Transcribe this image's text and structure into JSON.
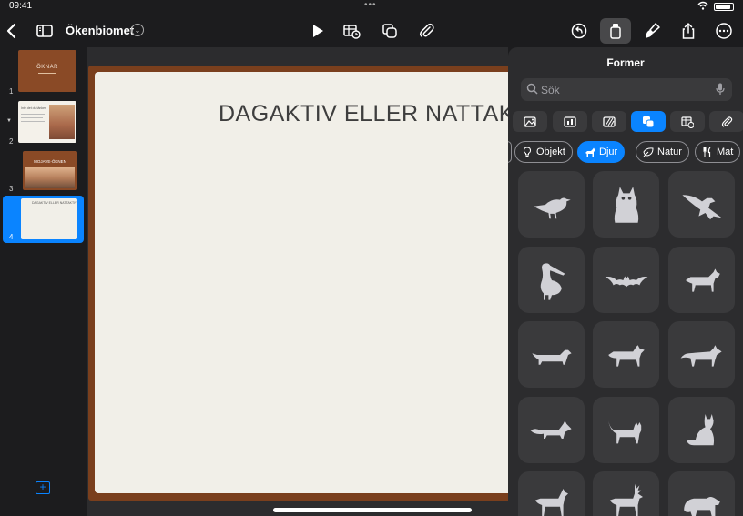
{
  "status": {
    "time": "09:41"
  },
  "toolbar": {
    "document_title": "Ökenbiomet"
  },
  "navigator": {
    "slides": [
      {
        "number": "1",
        "caption": "ÖKNAR"
      },
      {
        "number": "2",
        "caption": "Inte det du tänker"
      },
      {
        "number": "3",
        "caption": "MOJAVE-ÖKNEN"
      },
      {
        "number": "4",
        "caption": "DAGAKTIV ELLER NATTAKTIV"
      }
    ]
  },
  "slide": {
    "title": "DAGAKTIV ELLER NATTAKTIV"
  },
  "shapes_panel": {
    "title": "Former",
    "search_placeholder": "Sök",
    "categories": [
      {
        "label": "Objekt",
        "icon": "bulb-icon"
      },
      {
        "label": "Djur",
        "icon": "dog-icon",
        "selected": true
      },
      {
        "label": "Natur",
        "icon": "leaf-icon"
      },
      {
        "label": "Mat",
        "icon": "fork-knife-icon"
      }
    ],
    "shapes": [
      "bird-icon",
      "owl-icon",
      "eagle-icon",
      "pelican-icon",
      "bat-icon",
      "dog-icon",
      "dachshund-icon",
      "wolf-icon",
      "coyote-icon",
      "fox-icon",
      "cat-icon",
      "sitting-cat-icon",
      "deer-icon",
      "stag-icon",
      "bear-icon"
    ]
  },
  "colors": {
    "accent": "#0a84ff",
    "slide_frame": "#7a3f1d",
    "panel": "#2c2c2e"
  }
}
